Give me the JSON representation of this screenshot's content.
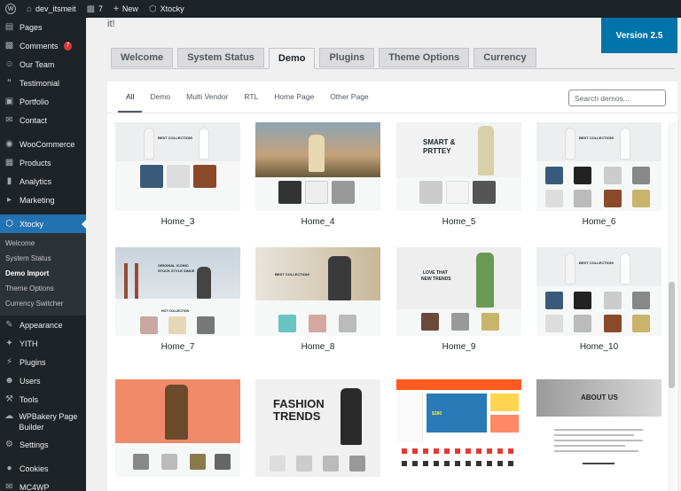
{
  "adminbar": {
    "site": "dev_itsmeit",
    "comments": "7",
    "new": "New",
    "theme": "Xtocky"
  },
  "sidebar": {
    "items": [
      {
        "label": "Pages",
        "icon": "pages-icon"
      },
      {
        "label": "Comments",
        "icon": "comments-icon",
        "badge": "7"
      },
      {
        "label": "Our Team",
        "icon": "team-icon"
      },
      {
        "label": "Testimonial",
        "icon": "quote-icon"
      },
      {
        "label": "Portfolio",
        "icon": "portfolio-icon"
      },
      {
        "label": "Contact",
        "icon": "mail-icon"
      },
      {
        "label": "WooCommerce",
        "icon": "woocommerce-icon"
      },
      {
        "label": "Products",
        "icon": "archive-icon"
      },
      {
        "label": "Analytics",
        "icon": "chart-icon"
      },
      {
        "label": "Marketing",
        "icon": "megaphone-icon"
      },
      {
        "label": "Xtocky",
        "icon": "xtocky-icon"
      },
      {
        "label": "Appearance",
        "icon": "brush-icon"
      },
      {
        "label": "YITH",
        "icon": "yith-icon"
      },
      {
        "label": "Plugins",
        "icon": "plugin-icon"
      },
      {
        "label": "Users",
        "icon": "users-icon"
      },
      {
        "label": "Tools",
        "icon": "wrench-icon"
      },
      {
        "label": "WPBakery Page Builder",
        "icon": "wpbakery-icon"
      },
      {
        "label": "Settings",
        "icon": "settings-icon"
      },
      {
        "label": "Cookies",
        "icon": "cookie-icon"
      },
      {
        "label": "MC4WP",
        "icon": "mc4wp-icon"
      }
    ],
    "submenu": [
      "Welcome",
      "System Status",
      "Demo Import",
      "Theme Options",
      "Currency Switcher"
    ]
  },
  "main": {
    "top_text": "it!",
    "version": "Version 2.5",
    "tabs": [
      "Welcome",
      "System Status",
      "Demo",
      "Plugins",
      "Theme Options",
      "Currency"
    ],
    "filters": [
      "All",
      "Demo",
      "Multi Vendor",
      "RTL",
      "Home Page",
      "Other Page"
    ],
    "search_placeholder": "Search demos...",
    "demos": [
      "Home_3",
      "Home_4",
      "Home_5",
      "Home_6",
      "Home_7",
      "Home_8",
      "Home_9",
      "Home_10",
      "",
      "",
      "",
      ""
    ],
    "thumb_text": {
      "home3": "BEST COLLECTION!",
      "home5_a": "SMART &",
      "home5_b": "PRTTEY",
      "home6": "BEST COLLECTION!",
      "home7_a": "ORIGINAL ICONIC",
      "home7_b": "STOCK STYLE SINCE",
      "home7_c": "HOT COLLECTION",
      "home8": "BEST COLLECTION!",
      "home9_a": "LOVE THAT",
      "home9_b": "NEW TRENDS",
      "home10": "BEST COLLECTION!",
      "r3b_a": "FASHION",
      "r3b_b": "TRENDS",
      "r3d": "ABOUT US",
      "r3c_price": "$280"
    }
  },
  "colors": {
    "accent": "#2271b1",
    "version_bg": "#0073aa",
    "adminbar": "#1d2327",
    "badge": "#d63638"
  }
}
